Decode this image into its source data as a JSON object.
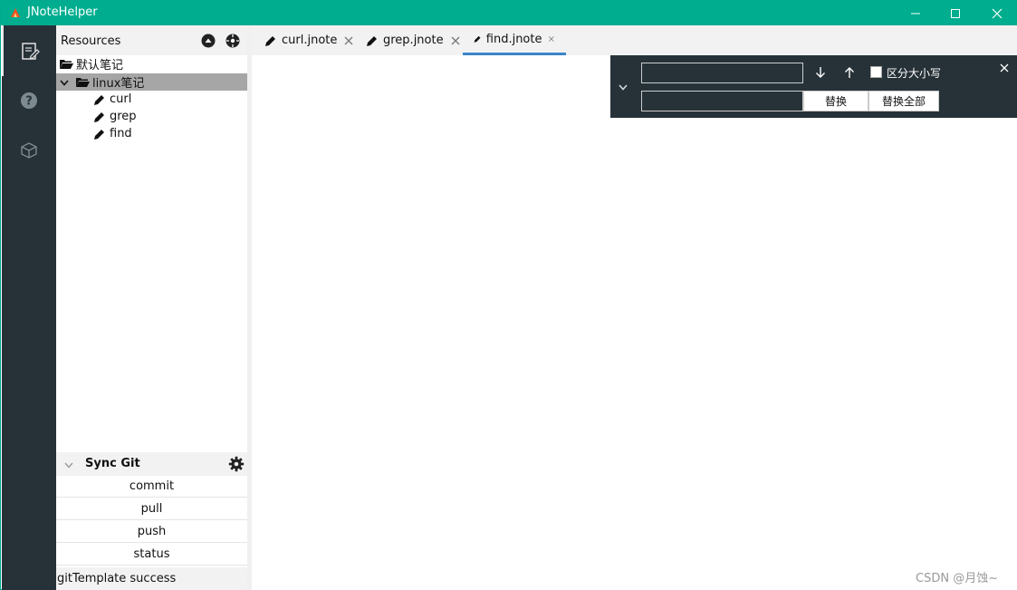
{
  "window": {
    "title": "JNoteHelper",
    "accent_color": "#00ad8f"
  },
  "activity_bar": {
    "items": [
      {
        "icon": "notes-edit-icon"
      },
      {
        "icon": "help-circle-icon"
      },
      {
        "icon": "cube-icon"
      }
    ],
    "background": "#263238"
  },
  "resources": {
    "title": "Resources",
    "tree": [
      {
        "label": "默认笔记",
        "icon": "folder-open-icon"
      },
      {
        "label": "linux笔记",
        "icon": "folder-open-icon",
        "selected": true
      },
      {
        "label": "curl",
        "icon": "pen-icon"
      },
      {
        "label": "grep",
        "icon": "pen-icon"
      },
      {
        "label": "find",
        "icon": "pen-icon"
      }
    ]
  },
  "sync_git": {
    "title": "Sync Git",
    "buttons": [
      "commit",
      "pull",
      "push",
      "status"
    ]
  },
  "status_message": "gitTemplate success",
  "tabs": [
    {
      "label": "curl.jnote"
    },
    {
      "label": "grep.jnote"
    },
    {
      "label": "find.jnote",
      "active": true
    }
  ],
  "find_widget": {
    "find_value": "",
    "replace_value": "",
    "case_label": "区分大小写",
    "replace_label": "替换",
    "replace_all_label": "替换全部"
  },
  "watermark": "CSDN @月蚀~"
}
